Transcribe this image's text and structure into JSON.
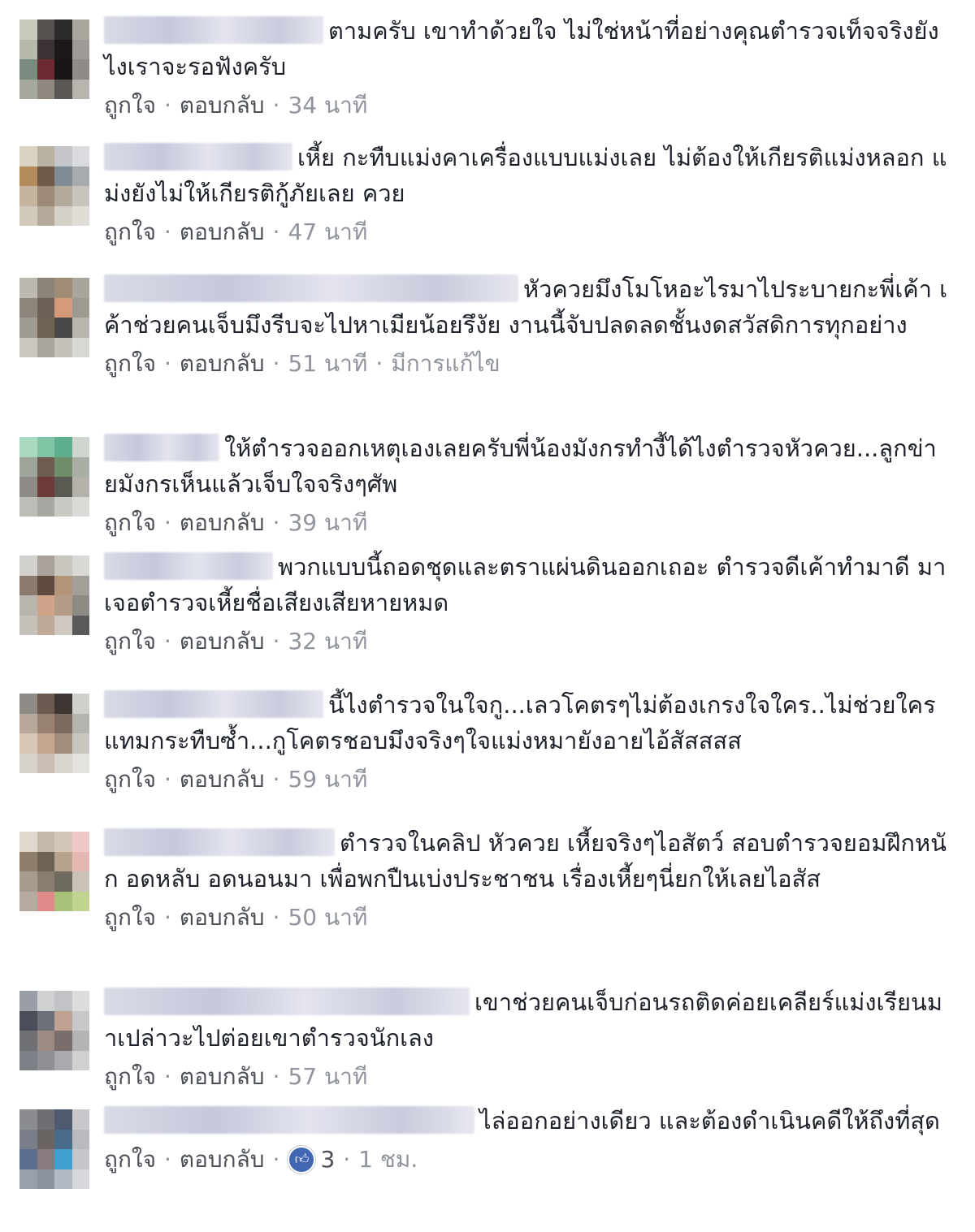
{
  "actions": {
    "like": "ถูกใจ",
    "reply": "ตอบกลับ",
    "separator": "·"
  },
  "comments": [
    {
      "text": "ตามครับ เขาทำด้วยใจ ไม่ใช่หน้าที่อย่างคุณตำรวจเท็จจริงยังไงเราจะรอฟังครับ",
      "time": "34 นาที"
    },
    {
      "text": "เหี้ย กะทืบแม่งคาเครื่องแบบแม่งเลย ไม่ต้องให้เกียรติแม่งหลอก แม่งยังไม่ให้เกียรติกู้ภัยเลย ควย",
      "time": "47 นาที"
    },
    {
      "text": "หัวควยมึงโมโหอะไรมาไประบายกะพี่เค้า เค้าช่วยคนเจ็บมึงรีบจะไปหาเมียน้อยรึงัย งานนี้จับปลดลดชั้นงดสวัสดิการทุกอย่าง",
      "time": "51 นาที",
      "edited": "มีการแก้ไข"
    },
    {
      "text": "ให้ตำรวจออกเหตุเองเลยครับพี่น้องมังกรทำงี้ได้ไงตำรวจหัวควย...ลูกข่ายมังกรเห็นแล้วเจ็บใจจริงๆศัพ",
      "time": "39 นาที"
    },
    {
      "text": "พวกแบบนี้ถอดชุดและตราแผ่นดินออกเถอะ ตำรวจดีเค้าทำมาดี มาเจอตำรวจเหี้ยชื่อเสียงเสียหายหมด",
      "time": "32 นาที"
    },
    {
      "text": "นี้ไงตำรวจในใจกู...เลวโคตรๆไม่ต้องเกรงใจใคร..ไม่ช่วยใครแทมกระทืบซ้ำ...กูโคตรชอบมึงจริงๆใจแม่งหมายังอายไอ้สัสสสส",
      "time": "59 นาที"
    },
    {
      "text": "ตำรวจในคลิป หัวควย เหี้ยจริงๆไอสัตว์ สอบตำรวจยอมฝึกหนัก อดหลับ อดนอนมา เพื่อพกปืนเบ่งประชาชน เรื่องเหี้ยๆนี่ยกให้เลยไอสัส",
      "time": "50 นาที"
    },
    {
      "text": "เขาช่วยคนเจ็บก่อนรถติดค่อยเคลียร์แม่งเรียนมาเปล่าวะไปต่อยเขาตำรวจนักเลง",
      "time": "57 นาที"
    },
    {
      "text": "ไล่ออกอย่างเดียว และต้องดำเนินคดีให้ถึงที่สุด",
      "time": "1 ชม.",
      "reactions": {
        "icon": "like-icon",
        "count": "3"
      }
    }
  ]
}
